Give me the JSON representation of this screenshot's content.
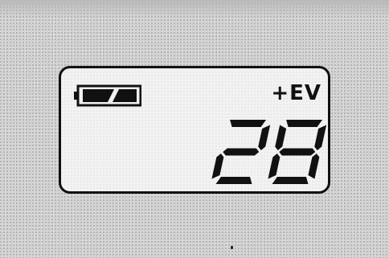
{
  "display": {
    "ev_indicator": "+EV",
    "value": "28",
    "battery_icon": "battery-icon",
    "battery_level": "partial"
  },
  "colors": {
    "segment": "#111111",
    "panel": "#f2f2f2",
    "background": "#d6d6d6"
  }
}
